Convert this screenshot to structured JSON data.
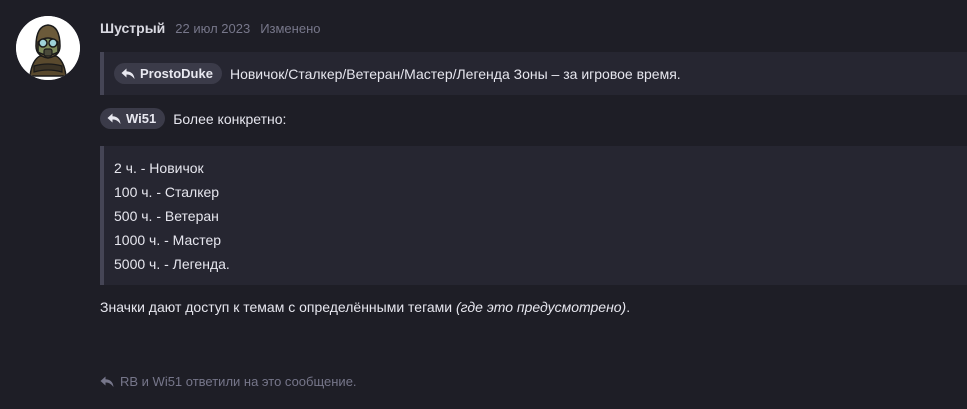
{
  "post": {
    "author": "Шустрый",
    "date": "22 июл 2023",
    "edited": "Изменено",
    "avatar_icon": "stalker-gasmask-avatar"
  },
  "quote1": {
    "mention": "ProstoDuke",
    "text": "Новичок/Сталкер/Ветеран/Мастер/Легенда Зоны – за игровое время."
  },
  "reply": {
    "mention": "Wi51",
    "text": "Более конкретно:"
  },
  "quote2": {
    "lines": [
      "2 ч. - Новичок",
      "100 ч. - Сталкер",
      "500 ч. - Ветеран",
      "1000 ч. - Мастер",
      "5000 ч. - Легенда."
    ]
  },
  "body": {
    "text": "Значки дают доступ к темам с определёнными тегами",
    "italic": "(где это предусмотрено)",
    "end": "."
  },
  "footer": {
    "text": "RB и Wi51 ответили на это сообщение.",
    "icon": "reply-icon"
  },
  "colors": {
    "background": "#1e1e26",
    "quote_background": "#262631",
    "quote_border": "#454555",
    "mention_background": "#3b3b49",
    "muted_text": "#77778a"
  }
}
